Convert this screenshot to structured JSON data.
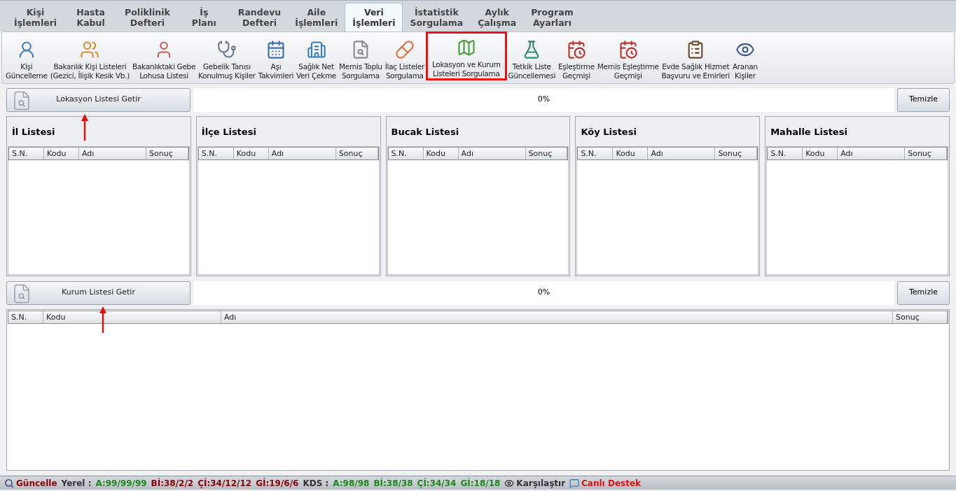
{
  "tabs": [
    {
      "label": "Kişi\nİşlemleri",
      "selected": false
    },
    {
      "label": "Hasta\nKabul",
      "selected": false
    },
    {
      "label": "Poliklinik\nDefteri",
      "selected": false
    },
    {
      "label": "İş\nPlanı",
      "selected": false
    },
    {
      "label": "Randevu\nDefteri",
      "selected": false
    },
    {
      "label": "Aile\nİşlemleri",
      "selected": false
    },
    {
      "label": "Veri\nİşlemleri",
      "selected": true
    },
    {
      "label": "İstatistik\nSorgulama",
      "selected": false
    },
    {
      "label": "Aylık\nÇalışma",
      "selected": false
    },
    {
      "label": "Program\nAyarları",
      "selected": false
    }
  ],
  "toolbar": [
    {
      "kind": "user-sync",
      "label": "Kişi\nGüncelleme",
      "highlighted": false
    },
    {
      "kind": "people",
      "label": "Bakanlık Kişi Listeleri\n(Gezici, İlişik Kesik Vb.)",
      "highlighted": false
    },
    {
      "kind": "woman",
      "label": "Bakanlıktaki Gebe\nLohusa Listesi",
      "highlighted": false
    },
    {
      "kind": "stethoscope",
      "label": "Gebelik Tanısı\nKonulmuş Kişiler",
      "highlighted": false
    },
    {
      "kind": "calendar",
      "label": "Aşı\nTakvimleri",
      "highlighted": false
    },
    {
      "kind": "building",
      "label": "Sağlık Net\nVeri Çekme",
      "highlighted": false
    },
    {
      "kind": "doc-search",
      "label": "Mernis Toplu\nSorgulama",
      "highlighted": false
    },
    {
      "kind": "pill",
      "label": "İlaç Listeler\nSorgulama",
      "highlighted": false
    },
    {
      "kind": "map",
      "label": "Lokasyon ve Kurum\nListeleri Sorgulama",
      "highlighted": true
    },
    {
      "kind": "flask",
      "label": "Tetkik Liste\nGüncellemesi",
      "highlighted": false
    },
    {
      "kind": "calendar-clock",
      "label": "Eşleştirme\nGeçmişi",
      "highlighted": false
    },
    {
      "kind": "calendar-clock",
      "label": "Mernis Eşleştirme\nGeçmişi",
      "highlighted": false
    },
    {
      "kind": "clipboard",
      "label": "Evde Sağlık Hizmet\nBaşvuru ve Emirleri",
      "highlighted": false
    },
    {
      "kind": "eye",
      "label": "Aranan\nKişiler",
      "highlighted": false
    }
  ],
  "location": {
    "button": "Lokasyon Listesi Getir",
    "progress": "0%",
    "level": 0,
    "clear_button": "Temizle",
    "lists": [
      {
        "title": "İl Listesi",
        "columns": [
          "S.N.",
          "Kodu",
          "Adı",
          "Sonuç"
        ]
      },
      {
        "title": "İlçe Listesi",
        "columns": [
          "S.N.",
          "Kodu",
          "Adı",
          "Sonuç"
        ]
      },
      {
        "title": "Bucak Listesi",
        "columns": [
          "S.N.",
          "Kodu",
          "Adı",
          "Sonuç"
        ]
      },
      {
        "title": "Köy Listesi",
        "columns": [
          "S.N.",
          "Kodu",
          "Adı",
          "Sonuç"
        ]
      },
      {
        "title": "Mahalle Listesi",
        "columns": [
          "S.N.",
          "Kodu",
          "Adı",
          "Sonuç"
        ]
      }
    ]
  },
  "institution": {
    "button": "Kurum Listesi Getir",
    "progress": "0%",
    "level": 0,
    "clear_button": "Temizle",
    "columns": [
      "S.N.",
      "Kodu",
      "Adı",
      "Sonuç"
    ]
  },
  "status_bar": [
    {
      "kind": "search",
      "text": "Güncelle",
      "color": "#8b0000"
    },
    {
      "kind": "text",
      "text": "Yerel :",
      "color": "#333333"
    },
    {
      "kind": "text",
      "text": "A:99/99/99",
      "color": "#1a8a1a"
    },
    {
      "kind": "text",
      "text": "Bİ:38/2/2",
      "color": "#8b0000"
    },
    {
      "kind": "text",
      "text": "Çİ:34/12/12",
      "color": "#8b0000"
    },
    {
      "kind": "text",
      "text": "Gİ:19/6/6",
      "color": "#8b0000"
    },
    {
      "kind": "text",
      "text": "KDS :",
      "color": "#333333"
    },
    {
      "kind": "text",
      "text": "A:98/98",
      "color": "#1a8a1a"
    },
    {
      "kind": "text",
      "text": "Bİ:38/38",
      "color": "#1a8a1a"
    },
    {
      "kind": "text",
      "text": "Çİ:34/34",
      "color": "#1a8a1a"
    },
    {
      "kind": "text",
      "text": "Gİ:18/18",
      "color": "#1a8a1a"
    },
    {
      "kind": "eye",
      "text": "Karşılaştır",
      "color": "#333333"
    },
    {
      "kind": "chat",
      "text": "Canlı Destek",
      "color": "#e01010"
    }
  ]
}
